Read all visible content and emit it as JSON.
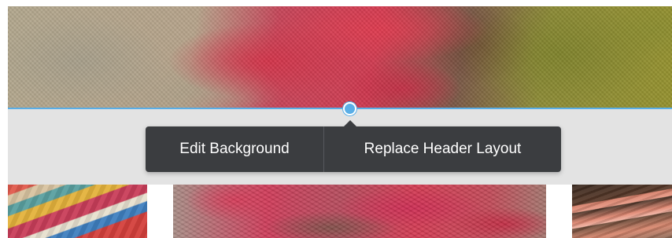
{
  "header": {
    "background_image": "graffiti-wall-photo"
  },
  "context_menu": {
    "edit_background_label": "Edit Background",
    "replace_header_layout_label": "Replace Header Layout"
  },
  "thumbnails": [
    {
      "image": "colorful-painted-wall-photo"
    },
    {
      "image": "red-graffiti-photo"
    },
    {
      "image": "pink-painted-wood-photo"
    }
  ],
  "colors": {
    "accent": "#5aaee6",
    "menu_background": "#3b3d40",
    "band_background": "#e3e3e3",
    "menu_text": "#ffffff"
  }
}
